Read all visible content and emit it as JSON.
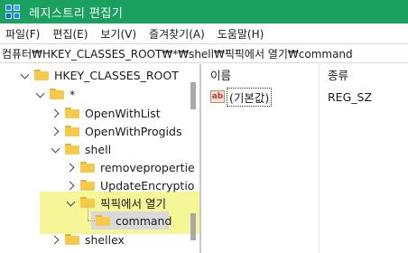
{
  "window": {
    "title": "레지스트리 편집기"
  },
  "menu": [
    "파일(F)",
    "편집(E)",
    "보기(V)",
    "즐겨찾기(A)",
    "도움말(H)"
  ],
  "address": "컴퓨터₩HKEY_CLASSES_ROOT₩*₩shell₩픽픽에서 열기₩command",
  "tree": {
    "root": "HKEY_CLASSES_ROOT",
    "star": "*",
    "openwithlist": "OpenWithList",
    "openwithprogids": "OpenWithProgids",
    "shell": "shell",
    "removeproperties": "removepropertie",
    "updateencryption": "UpdateEncryptio",
    "picpick": "픽픽에서 열기",
    "command": "command",
    "shellex": "shellex"
  },
  "values": {
    "col_name": "이름",
    "col_type": "종류",
    "rows": [
      {
        "icon": "ab",
        "name": "(기본값)",
        "type": "REG_SZ"
      }
    ]
  },
  "colors": {
    "titlebar": "#1aa160",
    "folder": "#f6c94b",
    "highlight": "#eeee46"
  }
}
